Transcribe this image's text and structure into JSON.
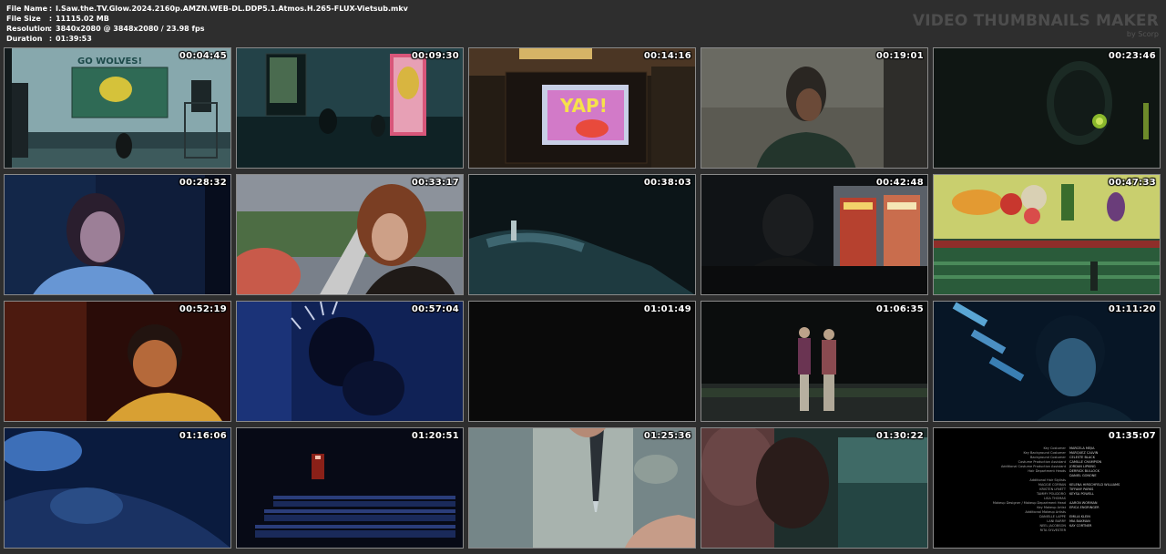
{
  "file_info": {
    "file_name_label": "File Name",
    "file_name": "I.Saw.the.TV.Glow.2024.2160p.AMZN.WEB-DL.DDP5.1.Atmos.H.265-FLUX-Vietsub.mkv",
    "file_size_label": "File Size",
    "file_size": "11115.02 MB",
    "resolution_label": "Resolution",
    "resolution": "3840x2080 @ 3848x2080 / 23.98 fps",
    "duration_label": "Duration",
    "duration": "01:39:53",
    "colon": ":"
  },
  "brand": {
    "title": "VIDEO THUMBNAILS MAKER",
    "subtitle": "by Scorp"
  },
  "thumbnails": [
    {
      "timestamp": "00:04:45"
    },
    {
      "timestamp": "00:09:30"
    },
    {
      "timestamp": "00:14:16"
    },
    {
      "timestamp": "00:19:01"
    },
    {
      "timestamp": "00:23:46"
    },
    {
      "timestamp": "00:28:32"
    },
    {
      "timestamp": "00:33:17"
    },
    {
      "timestamp": "00:38:03"
    },
    {
      "timestamp": "00:42:48"
    },
    {
      "timestamp": "00:47:33"
    },
    {
      "timestamp": "00:52:19"
    },
    {
      "timestamp": "00:57:04"
    },
    {
      "timestamp": "01:01:49"
    },
    {
      "timestamp": "01:06:35"
    },
    {
      "timestamp": "01:11:20"
    },
    {
      "timestamp": "01:16:06"
    },
    {
      "timestamp": "01:20:51"
    },
    {
      "timestamp": "01:25:36"
    },
    {
      "timestamp": "01:30:22"
    },
    {
      "timestamp": "01:35:07"
    }
  ],
  "scene_text": {
    "board_sign": "GO WOLVES!",
    "tv_text": "YAP!"
  },
  "credits": [
    {
      "role": "Key Costumer",
      "name": "MARCELA MEJIA"
    },
    {
      "role": "Key Background Costumer",
      "name": "MARQUEZ CALVIN"
    },
    {
      "role": "Background Costumer",
      "name": "CELESTE BLACK"
    },
    {
      "role": "Costume Production Assistant",
      "name": "CAMILLE CHAMPION"
    },
    {
      "role": "Additional Costume Production Assistant",
      "name": "JORDAN LIPKING"
    },
    {
      "role": "",
      "name": ""
    },
    {
      "role": "Hair Department Heads",
      "name": "DERRICK BULLOCK"
    },
    {
      "role": "",
      "name": "DANIEL GONONE"
    },
    {
      "role": "",
      "name": ""
    },
    {
      "role": "Additional Hair Stylists",
      "name": ""
    },
    {
      "role": "MAGGIE CORRAN",
      "name": "KELENA HIRSCHFELD WILLIAMS"
    },
    {
      "role": "KRISTEN LYNETT",
      "name": "TIFFANY PARKS"
    },
    {
      "role": "TAMMY POLIDORO",
      "name": "KEYSA POWELL"
    },
    {
      "role": "LISA THOMAS",
      "name": ""
    },
    {
      "role": "",
      "name": ""
    },
    {
      "role": "Makeup Designer / Makeup Department Head",
      "name": "AARON WORMAN"
    },
    {
      "role": "Key Makeup Artist",
      "name": "ERICA ENGRINGER"
    },
    {
      "role": "",
      "name": ""
    },
    {
      "role": "Additional Makeup Artists",
      "name": ""
    },
    {
      "role": "DANIELLE LAPPE",
      "name": "EMILIA KLEIN"
    },
    {
      "role": "LANI BARRY",
      "name": "MIA BAKMAN"
    },
    {
      "role": "NEEL JACOBSON",
      "name": "KAY CORTNER"
    },
    {
      "role": "RITA SYLVESTER",
      "name": ""
    }
  ]
}
